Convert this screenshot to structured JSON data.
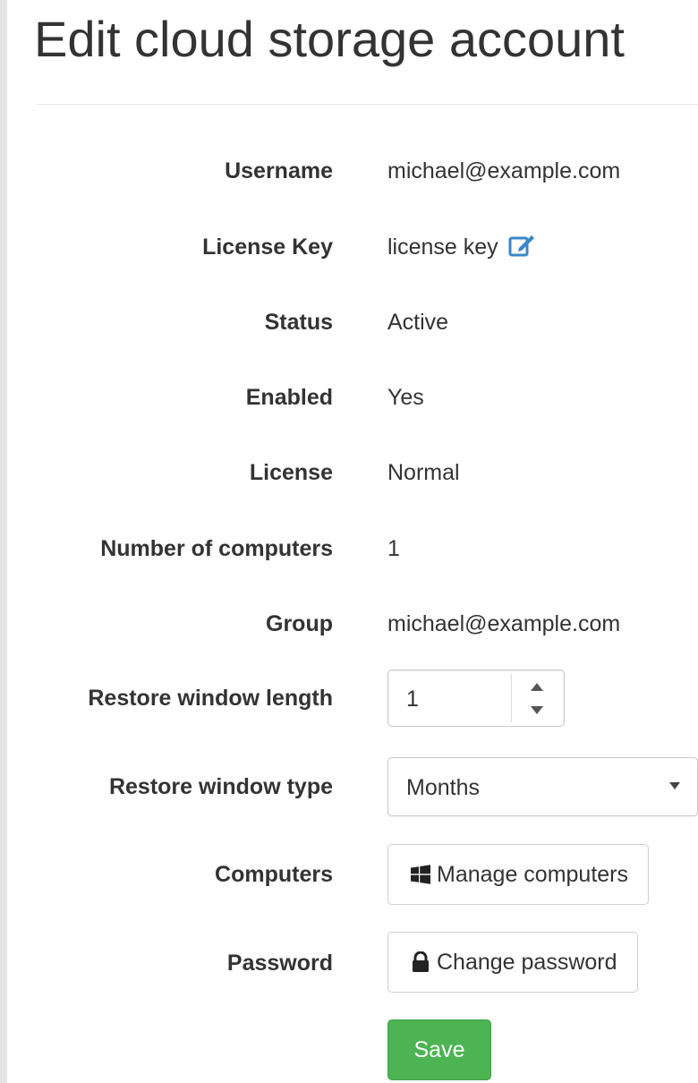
{
  "page": {
    "title": "Edit cloud storage account"
  },
  "fields": {
    "username": {
      "label": "Username",
      "value": "michael@example.com"
    },
    "license_key": {
      "label": "License Key",
      "value": "license key",
      "icon": "edit-icon"
    },
    "status": {
      "label": "Status",
      "value": "Active"
    },
    "enabled": {
      "label": "Enabled",
      "value": "Yes"
    },
    "license": {
      "label": "License",
      "value": "Normal"
    },
    "number_of_computers": {
      "label": "Number of computers",
      "value": "1"
    },
    "group": {
      "label": "Group",
      "value": "michael@example.com"
    },
    "restore_window_length": {
      "label": "Restore window length",
      "value": "1"
    },
    "restore_window_type": {
      "label": "Restore window type",
      "selected": "Months"
    },
    "computers": {
      "label": "Computers",
      "button_label": "Manage computers",
      "icon": "windows-icon"
    },
    "password": {
      "label": "Password",
      "button_label": "Change password",
      "icon": "lock-icon"
    }
  },
  "actions": {
    "save_label": "Save"
  },
  "colors": {
    "accent_link": "#3a87c8",
    "save_button": "#4cb453",
    "text": "#333333"
  }
}
